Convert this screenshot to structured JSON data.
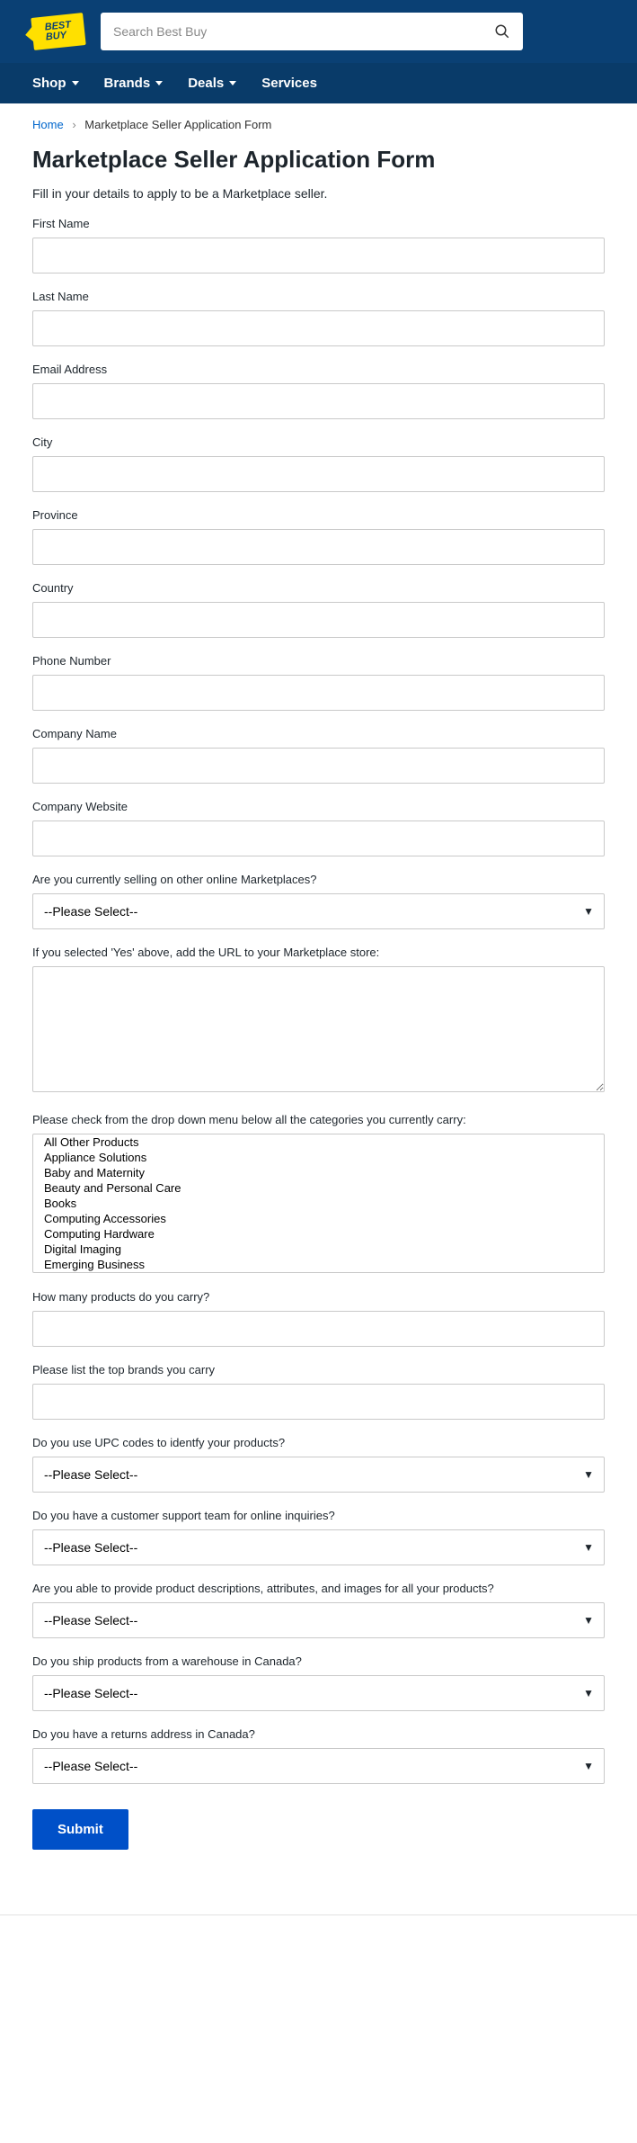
{
  "header": {
    "logo_text": "BEST\nBUY",
    "search_placeholder": "Search Best Buy"
  },
  "nav": {
    "items": [
      {
        "label": "Shop",
        "has_chevron": true
      },
      {
        "label": "Brands",
        "has_chevron": true
      },
      {
        "label": "Deals",
        "has_chevron": true
      },
      {
        "label": "Services",
        "has_chevron": false
      }
    ]
  },
  "breadcrumb": {
    "home": "Home",
    "current": "Marketplace Seller Application Form"
  },
  "page": {
    "title": "Marketplace Seller Application Form",
    "intro": "Fill in your details to apply to be a Marketplace seller."
  },
  "form": {
    "first_name_label": "First Name",
    "last_name_label": "Last Name",
    "email_label": "Email Address",
    "city_label": "City",
    "province_label": "Province",
    "country_label": "Country",
    "phone_label": "Phone Number",
    "company_name_label": "Company Name",
    "company_website_label": "Company Website",
    "selling_elsewhere_label": "Are you currently selling on other online Marketplaces?",
    "marketplace_url_label": "If you selected 'Yes' above, add the URL to your Marketplace store:",
    "categories_label": "Please check from the drop down menu below all the categories you currently carry:",
    "product_count_label": "How many products do you carry?",
    "top_brands_label": "Please list the top brands you carry",
    "upc_label": "Do you use UPC codes to identfy your products?",
    "support_team_label": "Do you have a customer support team for online inquiries?",
    "descriptions_label": "Are you able to provide product descriptions, attributes, and images for all your products?",
    "warehouse_label": "Do you ship products from a warehouse in Canada?",
    "returns_label": "Do you have a returns address in Canada?",
    "please_select": "--Please Select--",
    "categories": [
      "All Other Products",
      "Appliance Solutions",
      "Baby and Maternity",
      "Beauty and Personal Care",
      "Books",
      "Computing Accessories",
      "Computing Hardware",
      "Digital Imaging",
      "Emerging Business"
    ],
    "submit_label": "Submit"
  }
}
